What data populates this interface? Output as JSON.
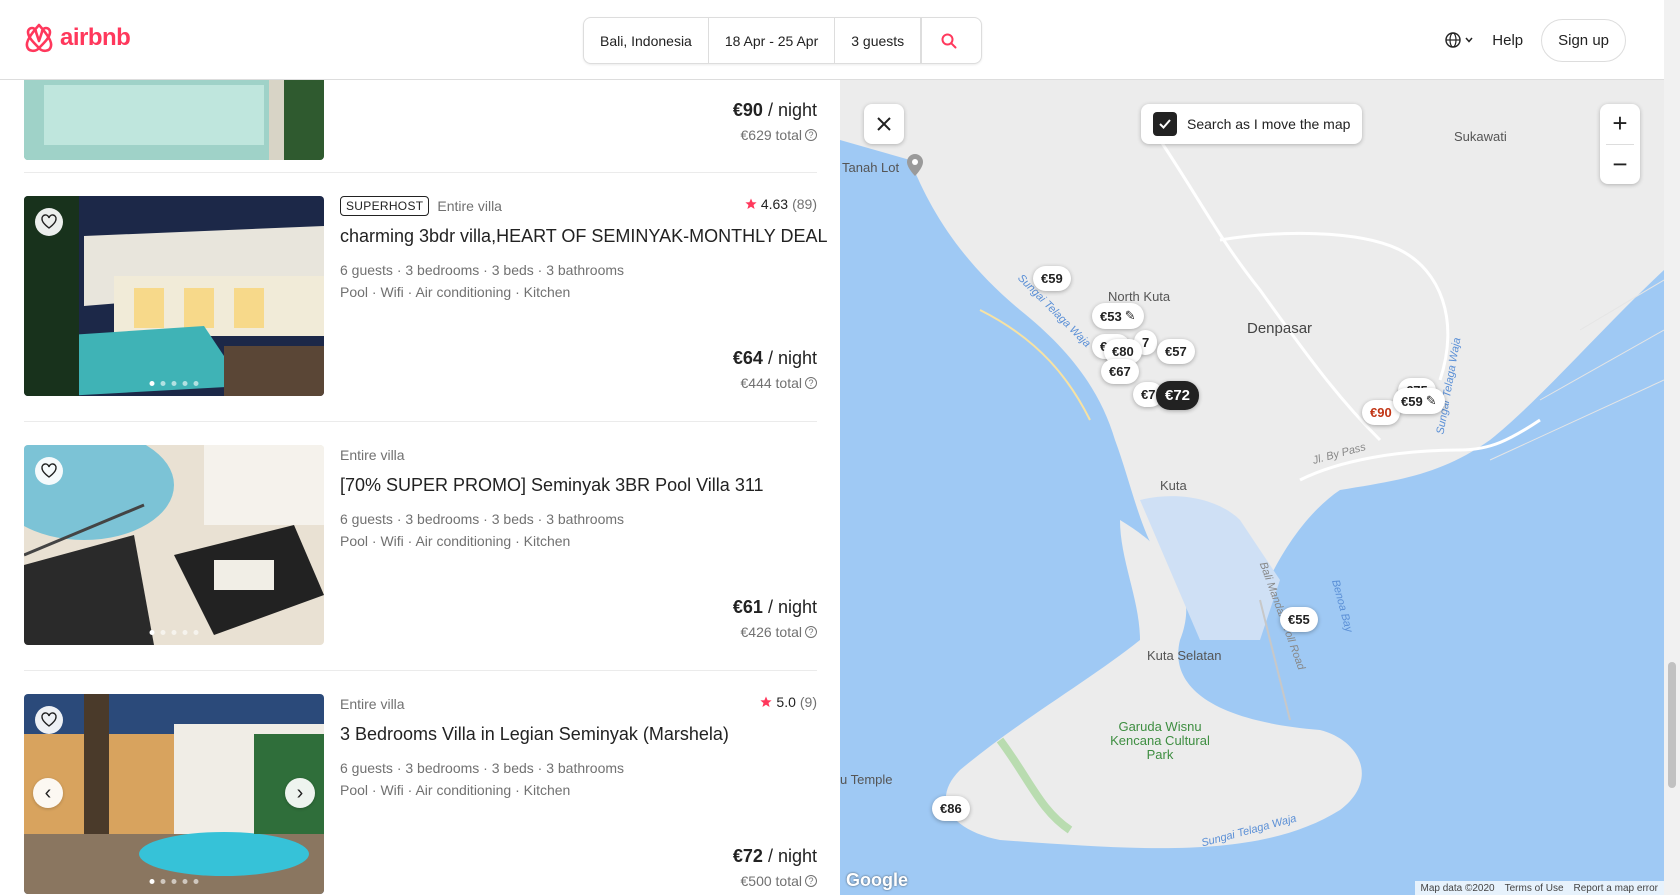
{
  "brand": {
    "name": "airbnb",
    "color": "#ff385c"
  },
  "search": {
    "location": "Bali, Indonesia",
    "dates": "18 Apr - 25 Apr",
    "guests": "3 guests"
  },
  "header_right": {
    "help": "Help",
    "signup": "Sign up",
    "language_icon": "globe-icon"
  },
  "listings": [
    {
      "night_price": "€90",
      "night_suffix": " / night",
      "total": "€629 total"
    },
    {
      "superhost": "SUPERHOST",
      "type": "Entire villa",
      "rating": "4.63",
      "reviews": "(89)",
      "title": "charming 3bdr villa,HEART OF SEMINYAK-MONTHLY DEAL",
      "specs": "6 guests · 3 bedrooms · 3 beds · 3 bathrooms",
      "amenities": "Pool · Wifi · Air conditioning · Kitchen",
      "night_price": "€64",
      "night_suffix": " / night",
      "total": "€444 total"
    },
    {
      "type": "Entire villa",
      "title": "[70% SUPER PROMO] Seminyak 3BR Pool Villa 311",
      "specs": "6 guests · 3 bedrooms · 3 beds · 3 bathrooms",
      "amenities": "Pool · Wifi · Air conditioning · Kitchen",
      "night_price": "€61",
      "night_suffix": " / night",
      "total": "€426 total"
    },
    {
      "type": "Entire villa",
      "rating": "5.0",
      "reviews": "(9)",
      "title": "3 Bedrooms Villa in Legian Seminyak (Marshela)",
      "specs": "6 guests · 3 bedrooms · 3 beds · 3 bathrooms",
      "amenities": "Pool · Wifi · Air conditioning · Kitchen",
      "night_price": "€72",
      "night_suffix": " / night",
      "total": "€500 total"
    }
  ],
  "map": {
    "search_toggle": "Search as I move the map",
    "labels": {
      "tanah_lot": "Tanah Lot",
      "sukawati": "Sukawati",
      "north_kuta": "North Kuta",
      "denpasar": "Denpasar",
      "kuta": "Kuta",
      "kuta_selatan": "Kuta Selatan",
      "garuda": "Garuda Wisnu Kencana Cultural Park",
      "temple": "u Temple",
      "sungai_telaga_waja": "Sungai Telaga Waja",
      "sungai_telaga_waja_2": "Sungai Telaga Waja",
      "sungai_telaga_waja_3": "Sungai Telaga Waja",
      "bypass": "Jl. By Pass",
      "toll": "Bali Mandara Toll Road",
      "benoa": "Benoa Bay"
    },
    "pins": {
      "p59": "€59",
      "p53": "€53",
      "p80": "€80",
      "p57": "€57",
      "p67": "€67",
      "p7a": "€7",
      "p72": "€72",
      "p90": "€90",
      "p59b": "€59",
      "p55": "€55",
      "p86": "€86",
      "p10": "€10",
      "p7b": "7",
      "p75": "€75"
    },
    "attribution": {
      "mapdata": "Map data ©2020",
      "terms": "Terms of Use",
      "report": "Report a map error"
    },
    "google": "Google"
  }
}
